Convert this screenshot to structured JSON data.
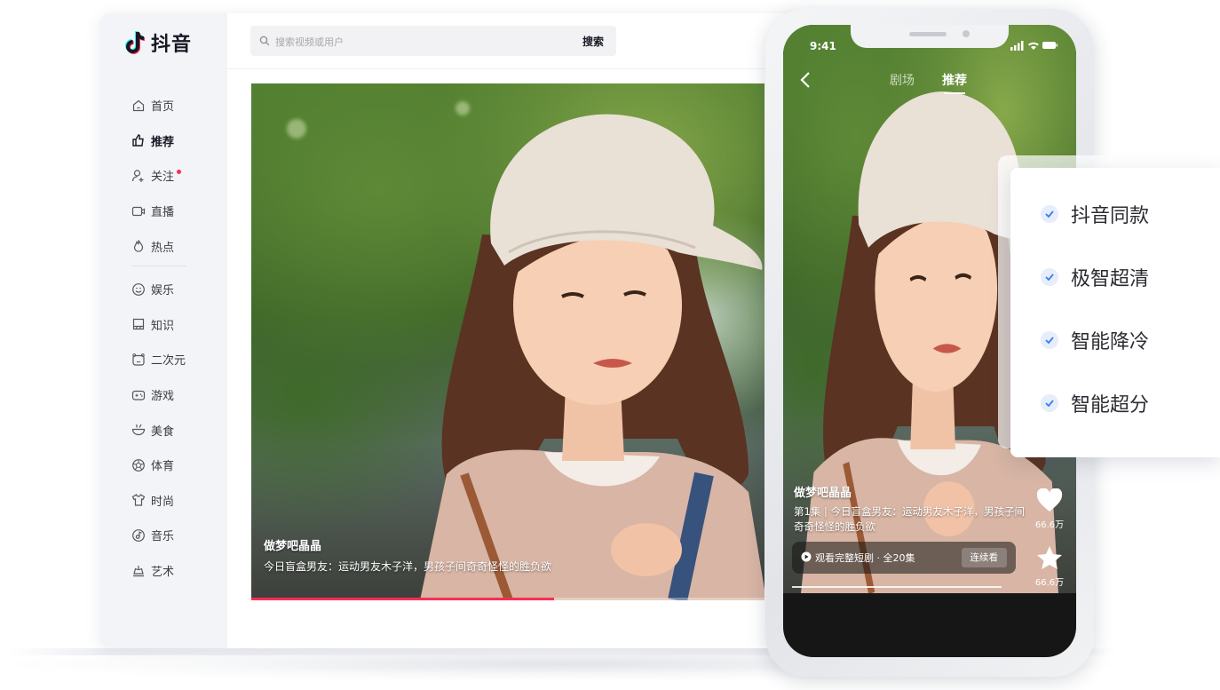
{
  "app": {
    "name": "抖音"
  },
  "search": {
    "placeholder": "搜索视频或用户",
    "button": "搜索"
  },
  "sidebar": {
    "items": [
      {
        "label": "首页",
        "icon": "home-icon",
        "active": false
      },
      {
        "label": "推荐",
        "icon": "thumbs-up-icon",
        "active": true
      },
      {
        "label": "关注",
        "icon": "follow-icon",
        "active": false,
        "badge_dot": true
      },
      {
        "label": "直播",
        "icon": "live-camera-icon",
        "active": false
      },
      {
        "label": "热点",
        "icon": "flame-icon",
        "active": false
      },
      {
        "label": "娱乐",
        "icon": "smile-icon",
        "active": false
      },
      {
        "label": "知识",
        "icon": "book-icon",
        "active": false
      },
      {
        "label": "二次元",
        "icon": "anime-icon",
        "active": false
      },
      {
        "label": "游戏",
        "icon": "gamepad-icon",
        "active": false
      },
      {
        "label": "美食",
        "icon": "food-bowl-icon",
        "active": false
      },
      {
        "label": "体育",
        "icon": "ball-icon",
        "active": false
      },
      {
        "label": "时尚",
        "icon": "shirt-icon",
        "active": false
      },
      {
        "label": "音乐",
        "icon": "music-icon",
        "active": false
      },
      {
        "label": "艺术",
        "icon": "art-icon",
        "active": false
      }
    ]
  },
  "video": {
    "author": "做梦吧晶晶",
    "description": "今日盲盒男友：运动男友木子洋，男孩子间奇奇怪怪的胜负欲",
    "progress": 0.59
  },
  "phone": {
    "time": "9:41",
    "tabs": [
      {
        "label": "剧场",
        "active": false
      },
      {
        "label": "推荐",
        "active": true
      }
    ],
    "author": "做梦吧晶晶",
    "description": "第1集 | 今日盲盒男友：运动男友木子洋，男孩子间奇奇怪怪的胜负欲",
    "series_bar": {
      "text": "观看完整短剧 · 全20集",
      "button": "连续看"
    },
    "likes": "66.6万",
    "favorites": "66.6万",
    "progress": 0.92
  },
  "features": [
    "抖音同款",
    "极智超清",
    "智能降冷",
    "智能超分"
  ],
  "colors": {
    "accent": "#fe2c55",
    "check": "#3a7bf0",
    "text": "#161823"
  }
}
